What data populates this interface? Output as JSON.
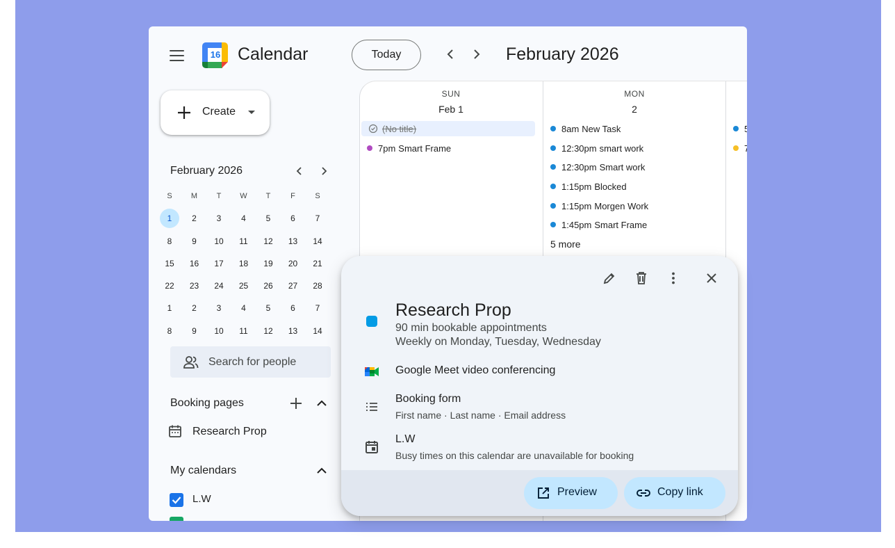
{
  "header": {
    "app_title": "Calendar",
    "logo_day": "16",
    "today_label": "Today",
    "month_title": "February 2026"
  },
  "create": {
    "label": "Create"
  },
  "mini_calendar": {
    "title": "February 2026",
    "weekdays": [
      "S",
      "M",
      "T",
      "W",
      "T",
      "F",
      "S"
    ],
    "weeks": [
      [
        "1",
        "2",
        "3",
        "4",
        "5",
        "6",
        "7"
      ],
      [
        "8",
        "9",
        "10",
        "11",
        "12",
        "13",
        "14"
      ],
      [
        "15",
        "16",
        "17",
        "18",
        "19",
        "20",
        "21"
      ],
      [
        "22",
        "23",
        "24",
        "25",
        "26",
        "27",
        "28"
      ],
      [
        "1",
        "2",
        "3",
        "4",
        "5",
        "6",
        "7"
      ],
      [
        "8",
        "9",
        "10",
        "11",
        "12",
        "13",
        "14"
      ]
    ],
    "selected": "1"
  },
  "search_people": {
    "placeholder": "Search for people"
  },
  "booking_pages": {
    "title": "Booking pages",
    "items": [
      {
        "label": "Research Prop"
      }
    ]
  },
  "my_calendars": {
    "title": "My calendars",
    "items": [
      {
        "label": "L.W",
        "color": "#1a73e8",
        "checked": true
      }
    ]
  },
  "days": [
    {
      "dow": "SUN",
      "date": "Feb 1",
      "events": [
        {
          "time": "",
          "title": "(No title)",
          "done": true,
          "color": "#747775"
        },
        {
          "time": "7pm",
          "title": "Smart Frame",
          "done": false,
          "color": "#b04bc1"
        }
      ]
    },
    {
      "dow": "MON",
      "date": "2",
      "events": [
        {
          "time": "8am",
          "title": "New Task",
          "color": "#1a88d6"
        },
        {
          "time": "12:30pm",
          "title": "smart work",
          "color": "#1a88d6"
        },
        {
          "time": "12:30pm",
          "title": "Smart work",
          "color": "#1a88d6"
        },
        {
          "time": "1:15pm",
          "title": "Blocked",
          "color": "#1a88d6"
        },
        {
          "time": "1:15pm",
          "title": "Morgen Work",
          "color": "#1a88d6"
        },
        {
          "time": "1:45pm",
          "title": "Smart Frame",
          "color": "#1a88d6"
        }
      ],
      "more": "5 more"
    },
    {
      "dow": "",
      "date": "",
      "events": [
        {
          "time": "5",
          "title": "",
          "color": "#1a88d6"
        },
        {
          "time": "7",
          "title": "",
          "color": "#f6bf26"
        }
      ]
    }
  ],
  "popup": {
    "title": "Research Prop",
    "color": "#039be5",
    "subtitle1": "90 min bookable appointments",
    "subtitle2": "Weekly on Monday, Tuesday, Wednesday",
    "meet": "Google Meet video conferencing",
    "form_title": "Booking form",
    "form_fields": "First name · Last name · Email address",
    "calendar": "L.W",
    "calendar_note": "Busy times on this calendar are unavailable for booking",
    "preview_label": "Preview",
    "copy_label": "Copy link"
  }
}
